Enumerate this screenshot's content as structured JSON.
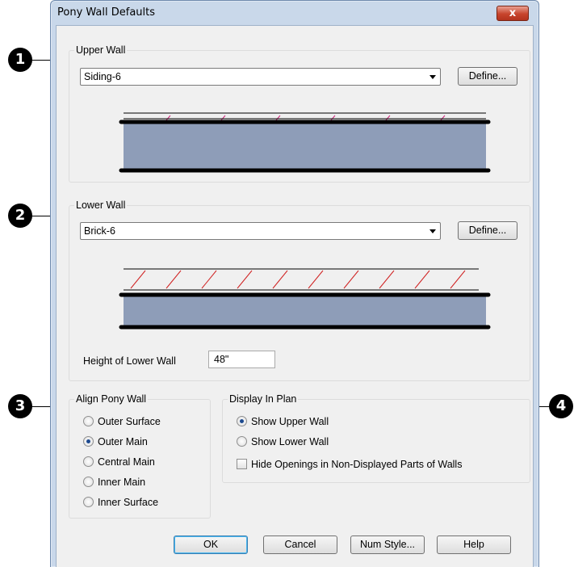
{
  "window": {
    "title": "Pony Wall Defaults",
    "close_glyph": "x"
  },
  "callouts": [
    "1",
    "2",
    "3",
    "4"
  ],
  "upper_wall": {
    "group_label": "Upper Wall",
    "selected_type": "Siding-6",
    "define_label": "Define..."
  },
  "lower_wall": {
    "group_label": "Lower Wall",
    "selected_type": "Brick-6",
    "define_label": "Define...",
    "height_label": "Height of Lower Wall",
    "height_value": "48\""
  },
  "align": {
    "group_label": "Align Pony Wall",
    "options": [
      {
        "label": "Outer Surface",
        "checked": false
      },
      {
        "label": "Outer Main",
        "checked": true
      },
      {
        "label": "Central Main",
        "checked": false
      },
      {
        "label": "Inner Main",
        "checked": false
      },
      {
        "label": "Inner Surface",
        "checked": false
      }
    ]
  },
  "display": {
    "group_label": "Display In Plan",
    "options": [
      {
        "label": "Show Upper Wall",
        "checked": true
      },
      {
        "label": "Show Lower Wall",
        "checked": false
      }
    ],
    "hide_openings_label": "Hide Openings in Non-Displayed Parts of Walls",
    "hide_openings_checked": false
  },
  "buttons": {
    "ok": "OK",
    "cancel": "Cancel",
    "num_style": "Num Style...",
    "help": "Help"
  },
  "colors": {
    "wall_fill": "#8e9db8",
    "hatch": "#d0207a",
    "brick_hatch": "#d02020"
  }
}
